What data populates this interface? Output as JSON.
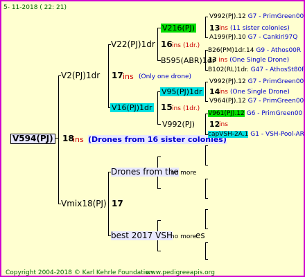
{
  "date": "5- 11-2018 ( 22: 21)",
  "root": {
    "name": "V594(PJ)",
    "num": "18",
    "ins": "ins",
    "note": "(Drones from 16 sister colonies)"
  },
  "mother": {
    "name": "V2(PJ)1dr",
    "num": "17",
    "ins": "ins",
    "note": "(Only one drone)"
  },
  "mm": {
    "name": "V22(PJ)1dr",
    "num": "16",
    "ins": "ins",
    "note": "(1dr.)"
  },
  "mmm": {
    "name": "V216(PJ)",
    "num": "13",
    "ins": "ins",
    "note": "(11 sister colonies)"
  },
  "mmm_line": {
    "name": "V992(PJ).12",
    "g": "G7",
    "tag": "PrimGreen00"
  },
  "mmm_father": {
    "name": "A199(PJ).10",
    "g": "G7",
    "tag": "Cankiri97Q"
  },
  "mmf": {
    "name": "B595(ABR)1dr"
  },
  "mmf_mother": {
    "name": "B26(PM)1dr.14",
    "g": "G9",
    "tag": "Athos00R"
  },
  "mmf_ins": {
    "num": "13",
    "ins": "ins",
    "note": "(One Single Drone)"
  },
  "mmf_father": {
    "name": "B102(RL)1dr.",
    "g": "G47",
    "tag": "AthosSt80R"
  },
  "mf": {
    "name": "V16(PJ)1dr",
    "num": "15",
    "ins": "ins",
    "note": "(1dr.)"
  },
  "mfm": {
    "name": "V95(PJ)1dr",
    "num": "14",
    "ins": "ins",
    "note": "(One Single Drone)"
  },
  "mfm_mother": {
    "name": "V992(PJ).12",
    "g": "G7",
    "tag": "PrimGreen00"
  },
  "mfm_father": {
    "name": "V964(PJ).12",
    "g": "G7",
    "tag": "PrimGreen00"
  },
  "mff": {
    "name": "V992(PJ)",
    "num": "12",
    "ins": "ins"
  },
  "mff_mother": {
    "name": "V961(PJ).12",
    "g": "G6",
    "tag": "PrimGreen00"
  },
  "mff_father": {
    "name": "capVSH-2A.1",
    "g": "G1",
    "tag": "VSH-Pool-AR"
  },
  "father": {
    "name": "Vmix18(PJ)",
    "num": "17"
  },
  "fm": {
    "name": "Drones from the",
    "note": "no more"
  },
  "ff": {
    "name": "best 2017 VSH",
    "note": "no more"
  },
  "ff_suffix": "es",
  "footer": {
    "copyright": "Copyright 2004-2018 © Karl Kehrle Foundation",
    "url": "www.pedigreeapis.org"
  },
  "colors": {
    "border": "#d000d0",
    "background": "#ffffd0",
    "green": "#00dd00",
    "cyan": "#00e0e0"
  }
}
